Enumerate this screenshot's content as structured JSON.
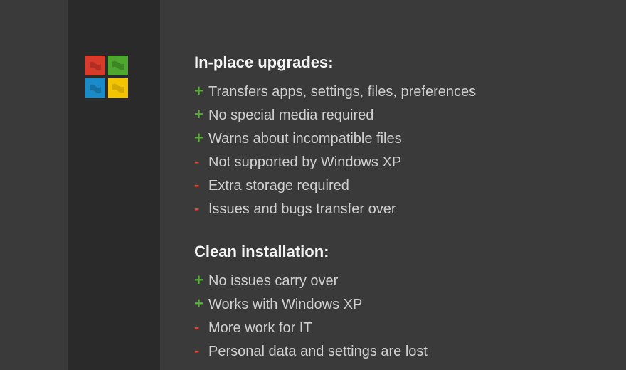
{
  "logo": {
    "tiles": [
      {
        "color": "#d83b2a"
      },
      {
        "color": "#4ea72e"
      },
      {
        "color": "#1a8bc9"
      },
      {
        "color": "#f2c500"
      }
    ]
  },
  "sections": [
    {
      "title": "In-place upgrades:",
      "items": [
        {
          "sign": "+",
          "text": "Transfers apps, settings, files, preferences"
        },
        {
          "sign": "+",
          "text": "No special media required"
        },
        {
          "sign": "+",
          "text": "Warns about incompatible files"
        },
        {
          "sign": "-",
          "text": "Not supported by Windows XP"
        },
        {
          "sign": "-",
          "text": "Extra storage required"
        },
        {
          "sign": "-",
          "text": "Issues and bugs transfer over"
        }
      ]
    },
    {
      "title": "Clean installation:",
      "items": [
        {
          "sign": "+",
          "text": "No issues carry over"
        },
        {
          "sign": "+",
          "text": "Works with Windows XP"
        },
        {
          "sign": "-",
          "text": "More work for IT"
        },
        {
          "sign": "-",
          "text": "Personal data and settings are lost"
        }
      ]
    }
  ]
}
